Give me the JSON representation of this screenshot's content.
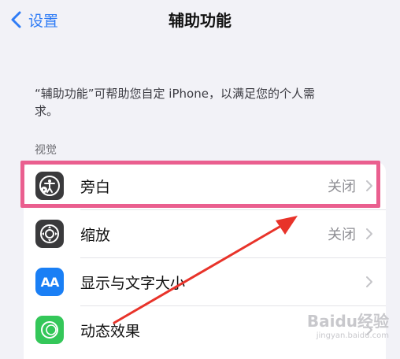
{
  "nav": {
    "back_label": "设置",
    "title": "辅助功能"
  },
  "description": "“辅助功能”可帮助您自定 iPhone，以满足您的个人需求。",
  "section": {
    "header": "视觉"
  },
  "rows": [
    {
      "label": "旁白",
      "value": "关闭",
      "icon": "voiceover-icon",
      "icon_color": "#3a3a3c"
    },
    {
      "label": "缩放",
      "value": "关闭",
      "icon": "zoom-icon",
      "icon_color": "#3a3a3c"
    },
    {
      "label": "显示与文字大小",
      "value": "",
      "icon": "text-size-icon",
      "icon_color": "#1a7ff5"
    },
    {
      "label": "动态效果",
      "value": "",
      "icon": "motion-icon",
      "icon_color": "#34c759"
    }
  ],
  "icon_glyphs": {
    "text_size": "AA"
  },
  "colors": {
    "accent": "#2f7cf6",
    "highlight": "#ea5f8f",
    "arrow": "#e8332a"
  },
  "watermark": {
    "main": "Baidu经验",
    "sub": "jingyan.baidu.com"
  }
}
